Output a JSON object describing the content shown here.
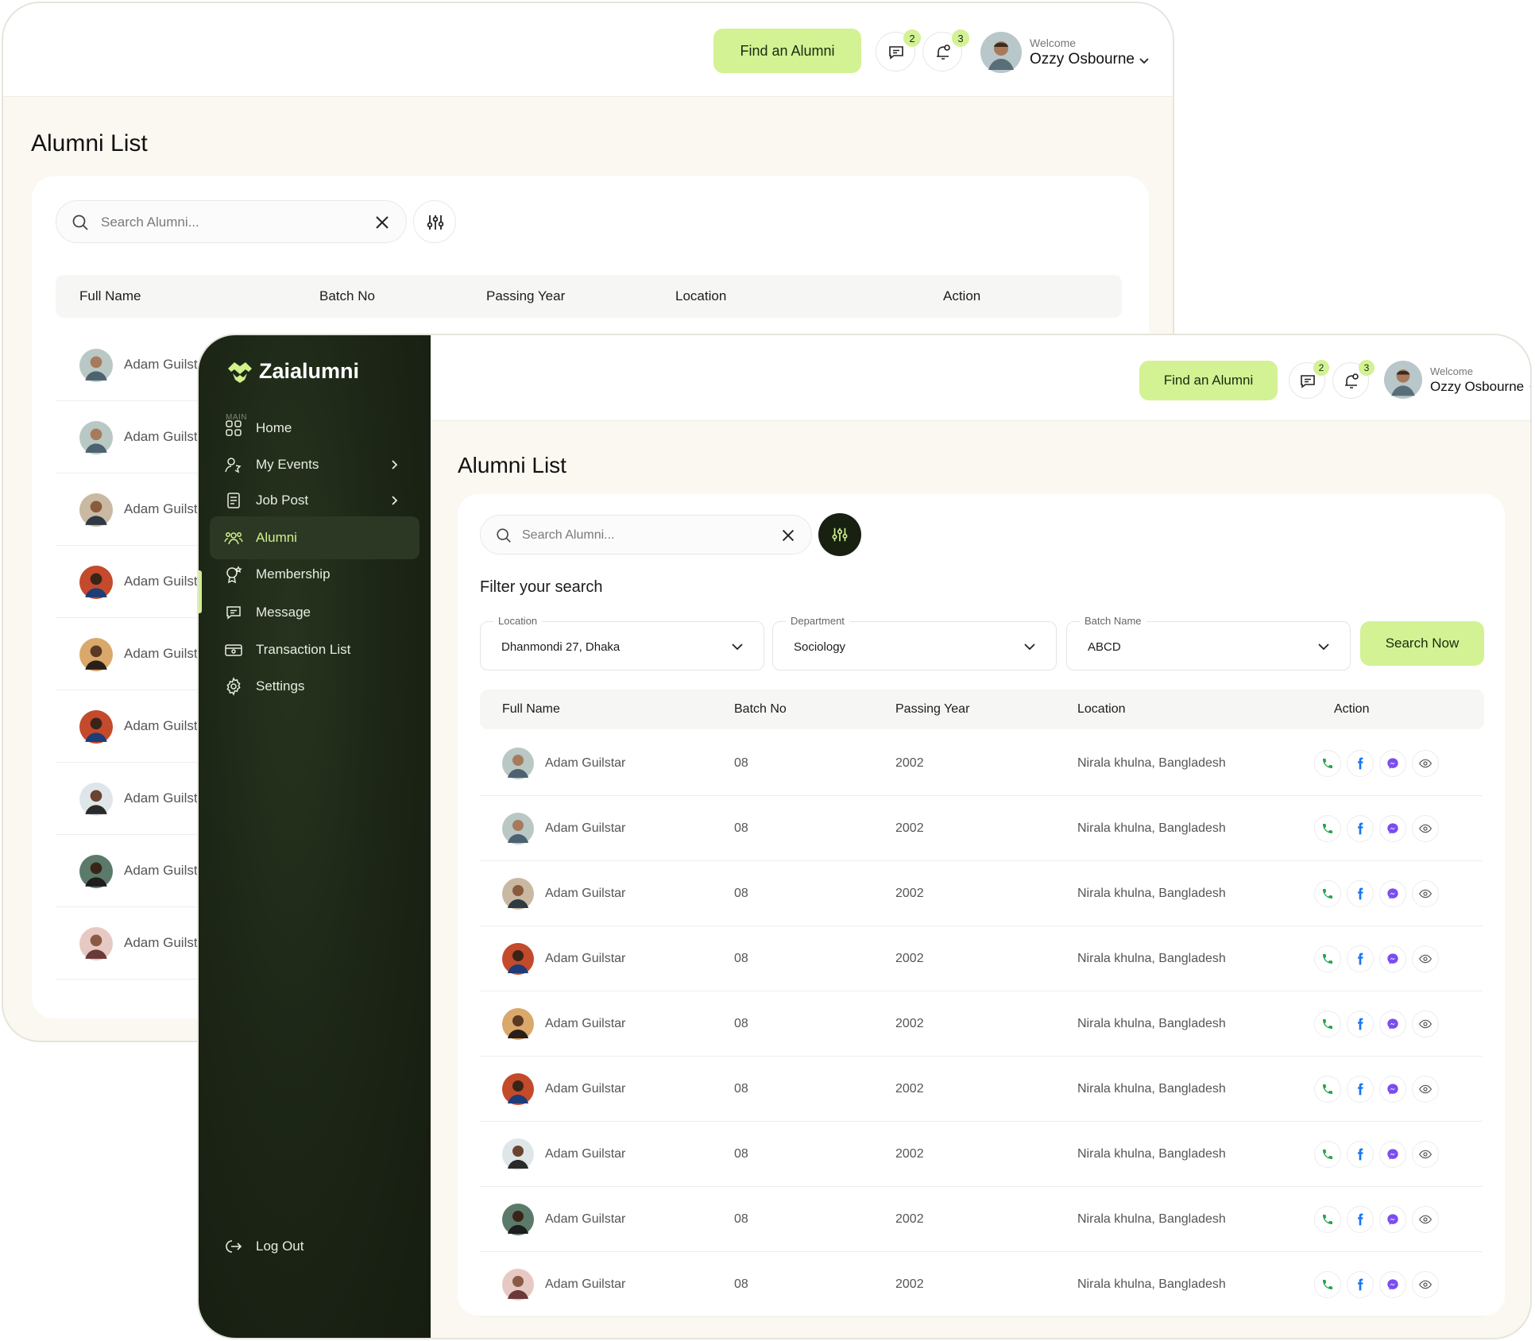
{
  "header": {
    "find_button": "Find an Alumni",
    "messages_count": "2",
    "notifications_count": "3",
    "welcome": "Welcome",
    "user_name": "Ozzy Osbourne"
  },
  "brand": {
    "name": "Zaialumni"
  },
  "sidebar": {
    "section": "MAIN",
    "items": [
      {
        "label": "Home",
        "icon": "grid-icon"
      },
      {
        "label": "My Events",
        "icon": "events-icon"
      },
      {
        "label": "Job Post",
        "icon": "document-icon"
      },
      {
        "label": "Alumni",
        "icon": "people-icon",
        "active": true
      },
      {
        "label": "Membership",
        "icon": "badge-icon"
      },
      {
        "label": "Message",
        "icon": "chat-icon"
      },
      {
        "label": "Transaction List",
        "icon": "wallet-icon"
      },
      {
        "label": "Settings",
        "icon": "gear-icon"
      }
    ],
    "logout": "Log Out"
  },
  "page": {
    "title": "Alumni List"
  },
  "search": {
    "placeholder": "Search Alumni..."
  },
  "filter": {
    "title": "Filter your search",
    "location": {
      "label": "Location",
      "value": "Dhanmondi 27, Dhaka"
    },
    "department": {
      "label": "Department",
      "value": "Sociology"
    },
    "batch": {
      "label": "Batch Name",
      "value": "ABCD"
    },
    "submit": "Search Now"
  },
  "table": {
    "columns": [
      "Full Name",
      "Batch No",
      "Passing Year",
      "Location",
      "Action"
    ],
    "rows": [
      {
        "name": "Adam Guilstar",
        "batch": "08",
        "year": "2002",
        "location": "Nirala khulna, Bangladesh"
      },
      {
        "name": "Adam Guilstar",
        "batch": "08",
        "year": "2002",
        "location": "Nirala khulna, Bangladesh"
      },
      {
        "name": "Adam Guilstar",
        "batch": "08",
        "year": "2002",
        "location": "Nirala khulna, Bangladesh"
      },
      {
        "name": "Adam Guilstar",
        "batch": "08",
        "year": "2002",
        "location": "Nirala khulna, Bangladesh"
      },
      {
        "name": "Adam Guilstar",
        "batch": "08",
        "year": "2002",
        "location": "Nirala khulna, Bangladesh"
      },
      {
        "name": "Adam Guilstar",
        "batch": "08",
        "year": "2002",
        "location": "Nirala khulna, Bangladesh"
      },
      {
        "name": "Adam Guilstar",
        "batch": "08",
        "year": "2002",
        "location": "Nirala khulna, Bangladesh"
      },
      {
        "name": "Adam Guilstar",
        "batch": "08",
        "year": "2002",
        "location": "Nirala khulna, Bangladesh"
      },
      {
        "name": "Adam Guilstar",
        "batch": "08",
        "year": "2002",
        "location": "Nirala khulna, Bangladesh"
      }
    ],
    "back_rows": [
      {
        "name": "Adam Guilstar"
      },
      {
        "name": "Adam Guilst"
      },
      {
        "name": "Adam Guilst"
      },
      {
        "name": "Adam Guilst"
      },
      {
        "name": "Adam Guilst"
      },
      {
        "name": "Adam Guilst"
      },
      {
        "name": "Adam Guilst"
      },
      {
        "name": "Adam Guilst"
      },
      {
        "name": "Adam Guilst"
      }
    ]
  },
  "colors": {
    "accent": "#d2f294",
    "sidebar": "#1b2415",
    "phone": "#22a447",
    "facebook": "#1877f2",
    "messenger": "#7a4cf0"
  }
}
